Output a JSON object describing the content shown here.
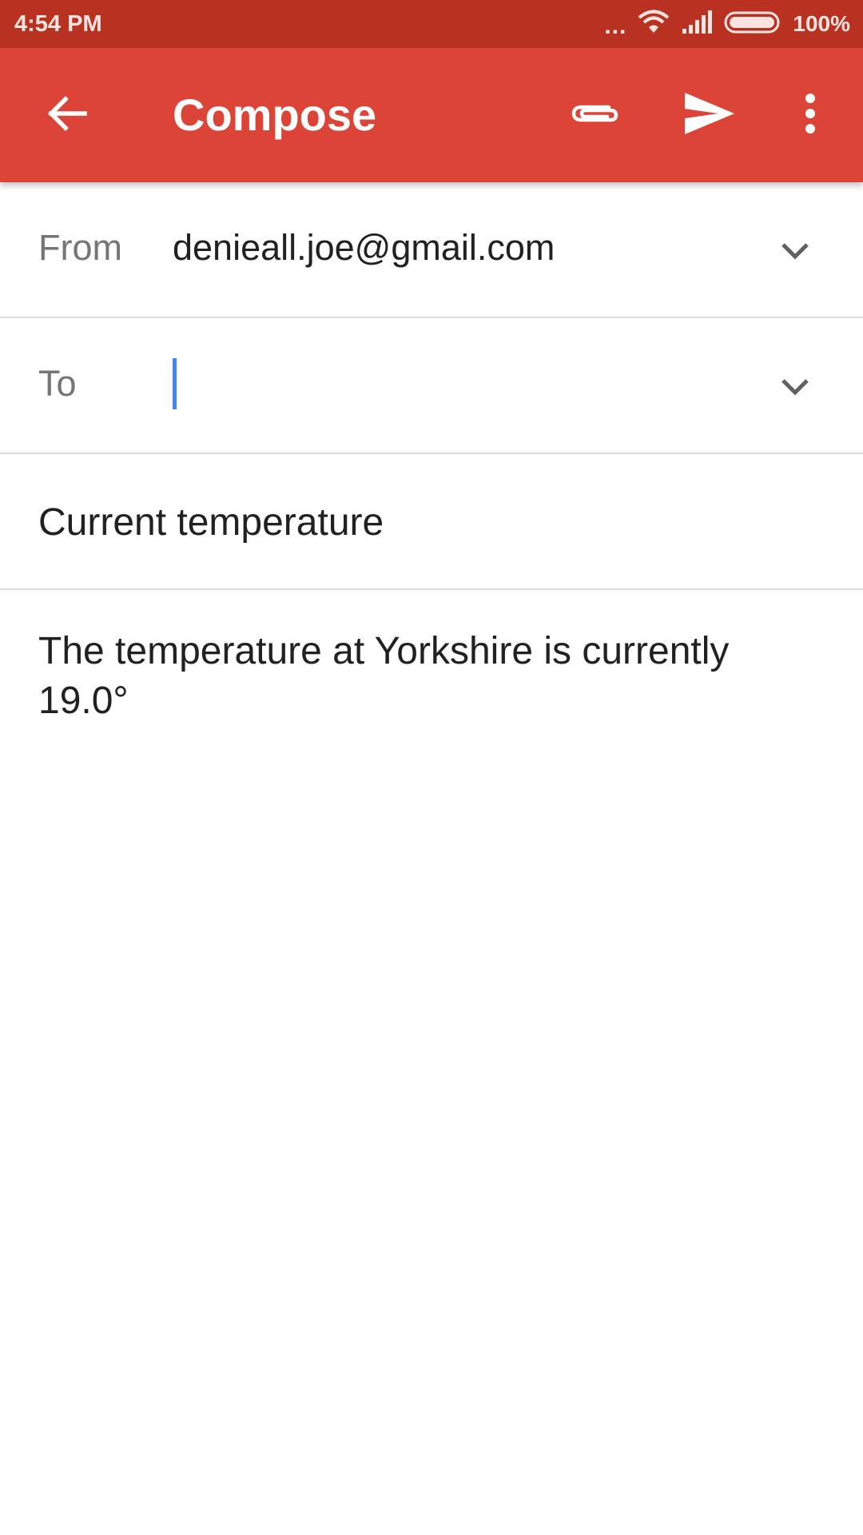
{
  "status_bar": {
    "time": "4:54 PM",
    "dots": "...",
    "battery_text": "100%",
    "icons": [
      "wifi-icon",
      "signal-icon",
      "battery-icon"
    ]
  },
  "toolbar": {
    "title": "Compose",
    "background_color": "#db4437",
    "icons": [
      "back-arrow-icon",
      "attachment-icon",
      "send-icon",
      "more-vert-icon"
    ]
  },
  "compose": {
    "from_label": "From",
    "from_value": "denieall.joe@gmail.com",
    "to_label": "To",
    "to_value": "",
    "subject": "Current temperature",
    "body": "The temperature at Yorkshire is currently 19.0°"
  },
  "colors": {
    "status_bar": "#b93221",
    "accent_cursor": "#4285f4"
  }
}
